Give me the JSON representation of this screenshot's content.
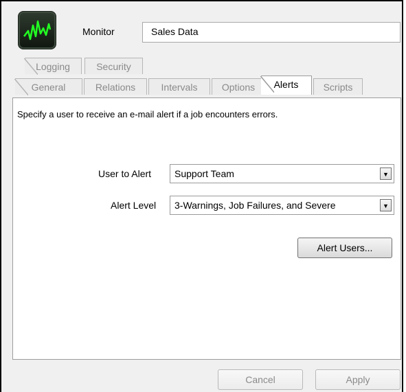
{
  "header": {
    "monitor_label": "Monitor",
    "monitor_value": "Sales Data",
    "logo_icon": "waveform-monitor-icon"
  },
  "tabs": {
    "row1": [
      {
        "label": "Logging"
      },
      {
        "label": "Security"
      }
    ],
    "row2": [
      {
        "label": "General"
      },
      {
        "label": "Relations"
      },
      {
        "label": "Intervals"
      },
      {
        "label": "Options"
      },
      {
        "label": "Alerts",
        "active": true
      },
      {
        "label": "Scripts"
      }
    ]
  },
  "alerts": {
    "description": "Specify a user to receive an e-mail alert if a job encounters errors.",
    "user_to_alert_label": "User to Alert",
    "user_to_alert_value": "Support Team",
    "alert_level_label": "Alert Level",
    "alert_level_value": "3-Warnings, Job Failures, and Severe",
    "alert_users_button": "Alert Users..."
  },
  "footer": {
    "cancel_label": "Cancel",
    "apply_label": "Apply"
  },
  "colors": {
    "logo_wave": "#22ff22",
    "panel_bg": "#ffffff",
    "window_bg": "#f0f0f0"
  }
}
